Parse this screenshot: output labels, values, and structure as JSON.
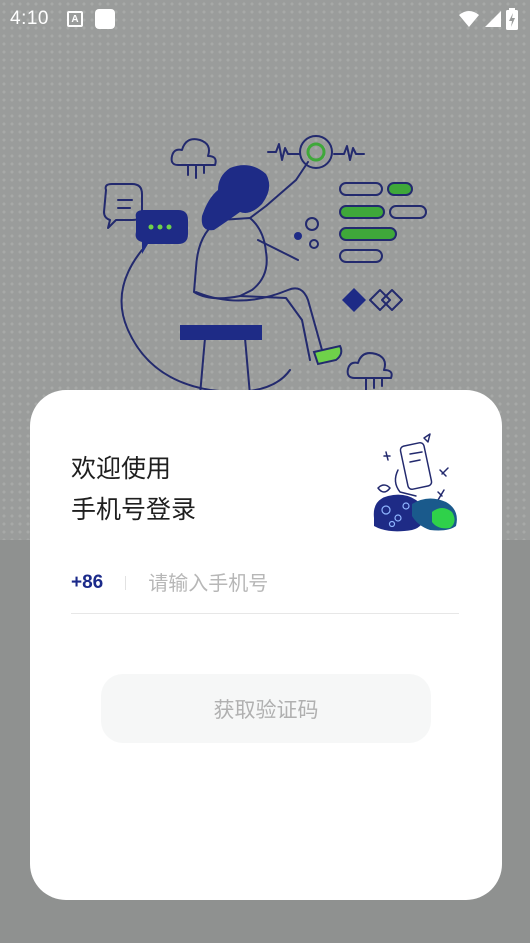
{
  "status_bar": {
    "time": "4:10",
    "notification_letter": "A",
    "icons": [
      "wifi-icon",
      "signal-icon",
      "battery-charging-icon"
    ]
  },
  "login": {
    "welcome_line1": "欢迎使用",
    "welcome_line2": "手机号登录",
    "country_code": "+86",
    "phone_placeholder": "请输入手机号",
    "phone_value": "",
    "get_code_label": "获取验证码"
  },
  "colors": {
    "accent_navy": "#1b2a8a",
    "accent_green": "#3fa83a",
    "button_disabled_text": "#b0b0b0"
  }
}
